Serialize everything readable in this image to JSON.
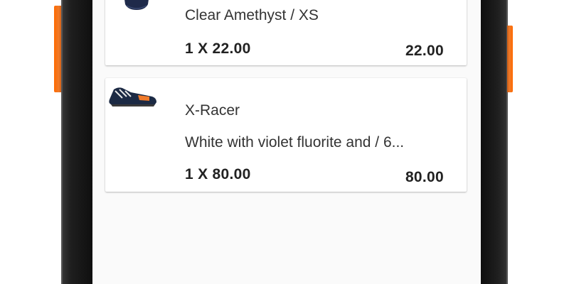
{
  "cart": {
    "items": [
      {
        "name": "",
        "variant": "Clear Amethyst / XS",
        "quantity_price": "1 X 22.00",
        "line_total": "22.00",
        "thumbnail_icon": "tshirt-icon",
        "thumbnail_color": "#1f2a4a"
      },
      {
        "name": "X-Racer",
        "variant": "White with violet fluorite and / 6...",
        "quantity_price": "1 X 80.00",
        "line_total": "80.00",
        "thumbnail_icon": "sneaker-icon",
        "thumbnail_color": "#1c2a44"
      }
    ]
  },
  "theme": {
    "accent": "#ff6a00",
    "frame": "#1a1a1a"
  }
}
